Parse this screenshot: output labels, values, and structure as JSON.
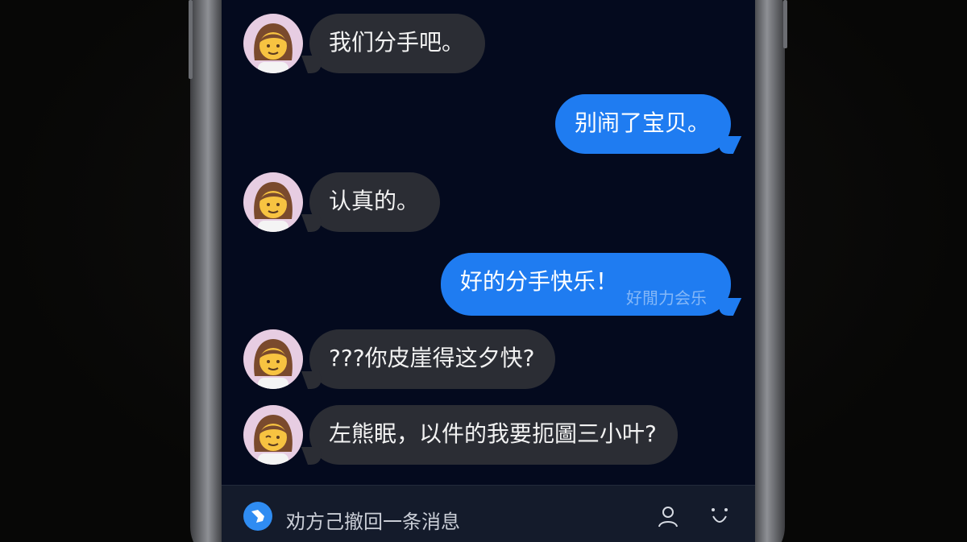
{
  "messages": [
    {
      "side": "incoming",
      "text": "我们分手吧。",
      "avatar": "woman-avatar"
    },
    {
      "side": "outgoing",
      "text": "别闹了宝贝。"
    },
    {
      "side": "incoming",
      "text": "认真的。",
      "avatar": "woman-avatar"
    },
    {
      "side": "outgoing",
      "text": "好的分手快乐！",
      "ghost_text": "好閒力会乐"
    },
    {
      "side": "incoming",
      "text": "???你皮崖得这夕快?",
      "avatar": "woman-avatar"
    },
    {
      "side": "incoming",
      "text": "左熊眠，以件的我要扼圖三小叶?",
      "avatar": "woman-avatar"
    }
  ],
  "bottom_bar": {
    "recall_notice": "劝方己撤回一条消息",
    "icons": [
      "recall-icon",
      "person-icon",
      "emoji-icon"
    ]
  },
  "colors": {
    "background": "#090807",
    "screen": "#040a1e",
    "incoming_bubble": "#2b2d34",
    "outgoing_bubble": "#1f7cf1",
    "avatar_bg": "#e7cde2",
    "accent": "#2f8cf2"
  }
}
